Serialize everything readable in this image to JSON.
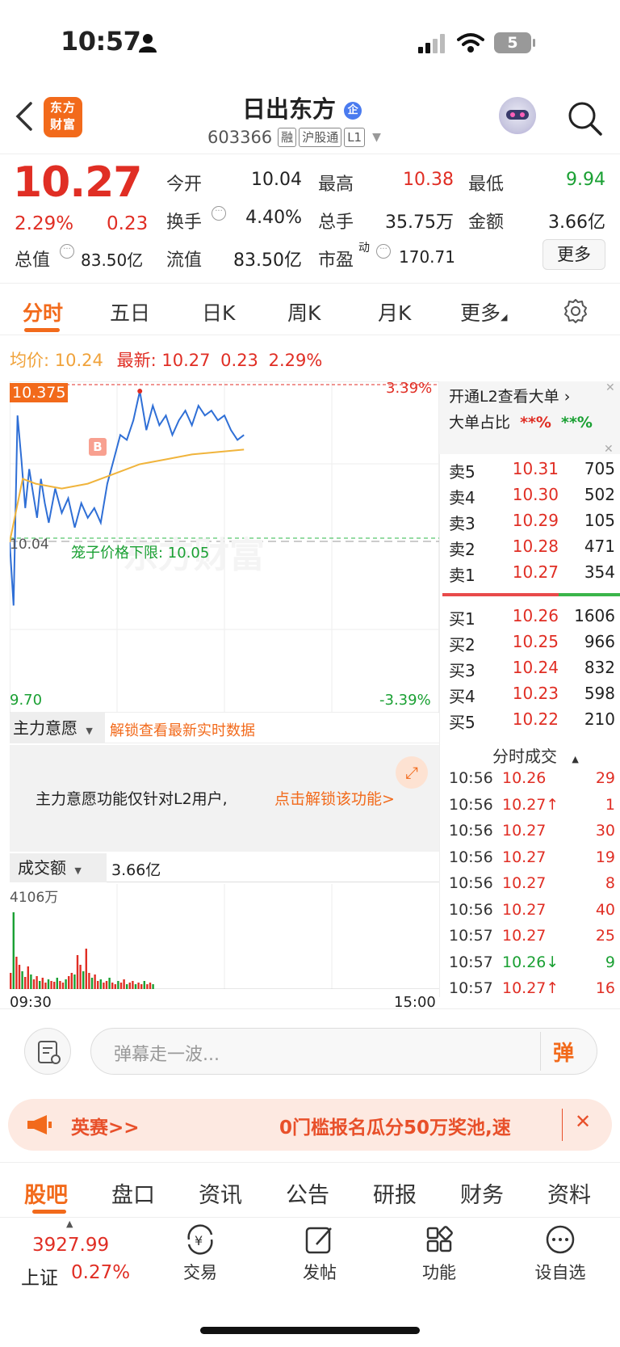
{
  "status_bar": {
    "time": "10:57",
    "battery": "5"
  },
  "header": {
    "logo_line1": "东方",
    "logo_line2": "财富",
    "stock_name": "日出东方",
    "badge": "企",
    "code": "603366",
    "tags": [
      "融",
      "沪股通",
      "L1"
    ]
  },
  "quote": {
    "price": "10.27",
    "change_pct": "2.29%",
    "change": "0.23",
    "open_label": "今开",
    "open": "10.04",
    "high_label": "最高",
    "high": "10.38",
    "low_label": "最低",
    "low": "9.94",
    "turnover_label": "换手",
    "turnover": "4.40%",
    "volume_label": "总手",
    "volume": "35.75万",
    "amount_label": "金额",
    "amount": "3.66亿",
    "mktcap_label": "总值",
    "mktcap": "83.50亿",
    "float_label": "流值",
    "float": "83.50亿",
    "pe_label": "市盈",
    "pe_sup": "动",
    "pe": "170.71",
    "more": "更多"
  },
  "chart_tabs": [
    "分时",
    "五日",
    "日K",
    "周K",
    "月K",
    "更多"
  ],
  "avg_line": {
    "avg_label": "均价:",
    "avg": "10.24",
    "last_label": "最新:",
    "last": "10.27",
    "chg": "0.23",
    "pct": "2.29%"
  },
  "chart": {
    "high_tag": "10.375",
    "top_pct": "3.39%",
    "open_tag": "10.04",
    "cage_label": "笼子价格下限: 10.05",
    "bottom_price": "9.70",
    "bottom_pct": "-3.39%",
    "marker_b": "B",
    "watermark": "东方财富"
  },
  "chart_data": {
    "type": "line",
    "x_range": [
      "09:30",
      "15:00"
    ],
    "ylim": [
      9.7,
      10.38
    ],
    "series": [
      {
        "x_minutes": [
          0,
          3,
          6,
          9,
          12,
          15,
          18,
          21,
          24,
          27,
          30,
          35,
          40,
          45,
          50,
          55,
          60,
          65,
          70,
          75,
          80,
          85,
          90,
          95,
          100,
          105,
          110,
          115,
          120,
          125,
          130,
          135,
          140,
          145,
          150,
          155,
          160,
          165,
          170,
          175,
          180
        ],
        "values": [
          10.05,
          9.92,
          10.31,
          10.22,
          10.12,
          10.2,
          10.15,
          10.1,
          10.18,
          10.13,
          10.09,
          10.16,
          10.11,
          10.14,
          10.08,
          10.13,
          10.1,
          10.12,
          10.09,
          10.17,
          10.22,
          10.27,
          10.26,
          10.3,
          10.36,
          10.28,
          10.33,
          10.29,
          10.31,
          10.27,
          10.3,
          10.32,
          10.29,
          10.33,
          10.31,
          10.32,
          10.3,
          10.31,
          10.28,
          10.26,
          10.27
        ]
      },
      {
        "x_minutes": [
          0,
          10,
          20,
          40,
          60,
          80,
          100,
          120,
          140,
          160,
          180
        ],
        "values": [
          10.05,
          10.18,
          10.17,
          10.16,
          10.17,
          10.19,
          10.21,
          10.22,
          10.23,
          10.235,
          10.24
        ]
      }
    ],
    "volume_max_label": "4106万"
  },
  "orderbook": {
    "banner_line1": "开通L2查看大单",
    "banner_line2_label": "大单占比",
    "banner_red": "**%",
    "banner_green": "**%",
    "asks": [
      {
        "label": "卖5",
        "price": "10.31",
        "vol": "705"
      },
      {
        "label": "卖4",
        "price": "10.30",
        "vol": "502"
      },
      {
        "label": "卖3",
        "price": "10.29",
        "vol": "105"
      },
      {
        "label": "卖2",
        "price": "10.28",
        "vol": "471"
      },
      {
        "label": "卖1",
        "price": "10.27",
        "vol": "354"
      }
    ],
    "bids": [
      {
        "label": "买1",
        "price": "10.26",
        "vol": "1606"
      },
      {
        "label": "买2",
        "price": "10.25",
        "vol": "966"
      },
      {
        "label": "买3",
        "price": "10.24",
        "vol": "832"
      },
      {
        "label": "买4",
        "price": "10.23",
        "vol": "598"
      },
      {
        "label": "买5",
        "price": "10.22",
        "vol": "210"
      }
    ],
    "ticks_title": "分时成交",
    "ticks": [
      {
        "time": "10:56",
        "price": "10.26",
        "vol": "29",
        "color": "red"
      },
      {
        "time": "10:56",
        "price": "10.27↑",
        "vol": "1",
        "color": "red"
      },
      {
        "time": "10:56",
        "price": "10.27",
        "vol": "30",
        "color": "red"
      },
      {
        "time": "10:56",
        "price": "10.27",
        "vol": "19",
        "color": "red"
      },
      {
        "time": "10:56",
        "price": "10.27",
        "vol": "8",
        "color": "red"
      },
      {
        "time": "10:56",
        "price": "10.27",
        "vol": "40",
        "color": "red"
      },
      {
        "time": "10:57",
        "price": "10.27",
        "vol": "25",
        "color": "red"
      },
      {
        "time": "10:57",
        "price": "10.26↓",
        "vol": "9",
        "color": "green"
      },
      {
        "time": "10:57",
        "price": "10.27↑",
        "vol": "16",
        "color": "red"
      }
    ]
  },
  "main_force": {
    "label": "主力意愿",
    "unlock": "解锁查看最新实时数据",
    "notice": "主力意愿功能仅针对L2用户,",
    "notice_link": "点击解锁该功能>"
  },
  "volume_panel": {
    "label": "成交额",
    "value": "3.66亿",
    "max": "4106万",
    "start": "09:30",
    "end": "15:00"
  },
  "danmu": {
    "placeholder": "弹幕走一波...",
    "send": "弹"
  },
  "promo": {
    "left": "英赛>>",
    "text": "0门槛报名瓜分50万奖池,速"
  },
  "sub_tabs": [
    "股吧",
    "盘口",
    "资讯",
    "公告",
    "研报",
    "财务",
    "资料"
  ],
  "bottom_nav": {
    "index_value": "3927.99",
    "index_name": "上证",
    "index_pct": "0.27%",
    "items": [
      "交易",
      "发帖",
      "功能",
      "设自选"
    ]
  },
  "colors": {
    "accent": "#f26a1b",
    "up": "#e02e24",
    "down": "#1aa033",
    "price_line": "#2f6fd6",
    "avg_line": "#f0b43c"
  }
}
